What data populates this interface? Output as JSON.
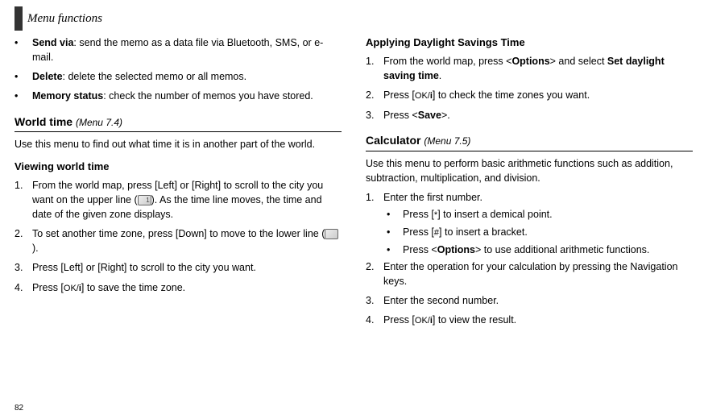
{
  "header": {
    "title": "Menu functions"
  },
  "pageNumber": "82",
  "left": {
    "bullets": [
      {
        "label": "Send via",
        "text": ": send the memo as a data file via Bluetooth, SMS, or e-mail."
      },
      {
        "label": "Delete",
        "text": ": delete the selected memo or all memos."
      },
      {
        "label": "Memory status",
        "text": ": check the number of memos you have stored."
      }
    ],
    "worldTime": {
      "title": "World time",
      "menu": "(Menu 7.4)",
      "intro": "Use this menu to find out what time it is in another part of the world.",
      "viewingHeading": "Viewing world time",
      "step1a": "From the world map, press [Left] or [Right] to scroll to the city you want on the upper line (",
      "step1b": "). As the time line moves, the time and date of the given zone displays.",
      "step2a": "To set another time zone, press [Down] to move to the lower line (",
      "step2b": ").",
      "step3": "Press [Left] or [Right] to scroll to the city you want.",
      "step4a": "Press [",
      "step4key": "OK/",
      "step4b": "] to save the time zone."
    }
  },
  "right": {
    "dst": {
      "heading": "Applying Daylight Savings Time",
      "s1a": "From the world map, press <",
      "s1b": "Options",
      "s1c": "> and select ",
      "s1d": "Set daylight saving time",
      "s1e": ".",
      "s2a": "Press [",
      "s2key": "OK/",
      "s2b": "] to check the time zones you want.",
      "s3a": "Press <",
      "s3b": "Save",
      "s3c": ">."
    },
    "calc": {
      "title": "Calculator",
      "menu": "(Menu 7.5)",
      "intro": "Use this menu to perform basic arithmetic functions such as addition, subtraction, multiplication, and division.",
      "s1": "Enter the first number.",
      "s1a_a": "Press [",
      "s1a_k": "*",
      "s1a_b": "] to insert a demical point.",
      "s1b_a": "Press [",
      "s1b_k": "#",
      "s1b_b": "] to insert a bracket.",
      "s1c_a": "Press <",
      "s1c_b": "Options",
      "s1c_c": "> to use additional arithmetic functions.",
      "s2": "Enter the operation for your calculation by pressing the Navigation keys.",
      "s3": "Enter the second number.",
      "s4a": "Press [",
      "s4key": "OK/",
      "s4b": "] to view the result."
    }
  }
}
